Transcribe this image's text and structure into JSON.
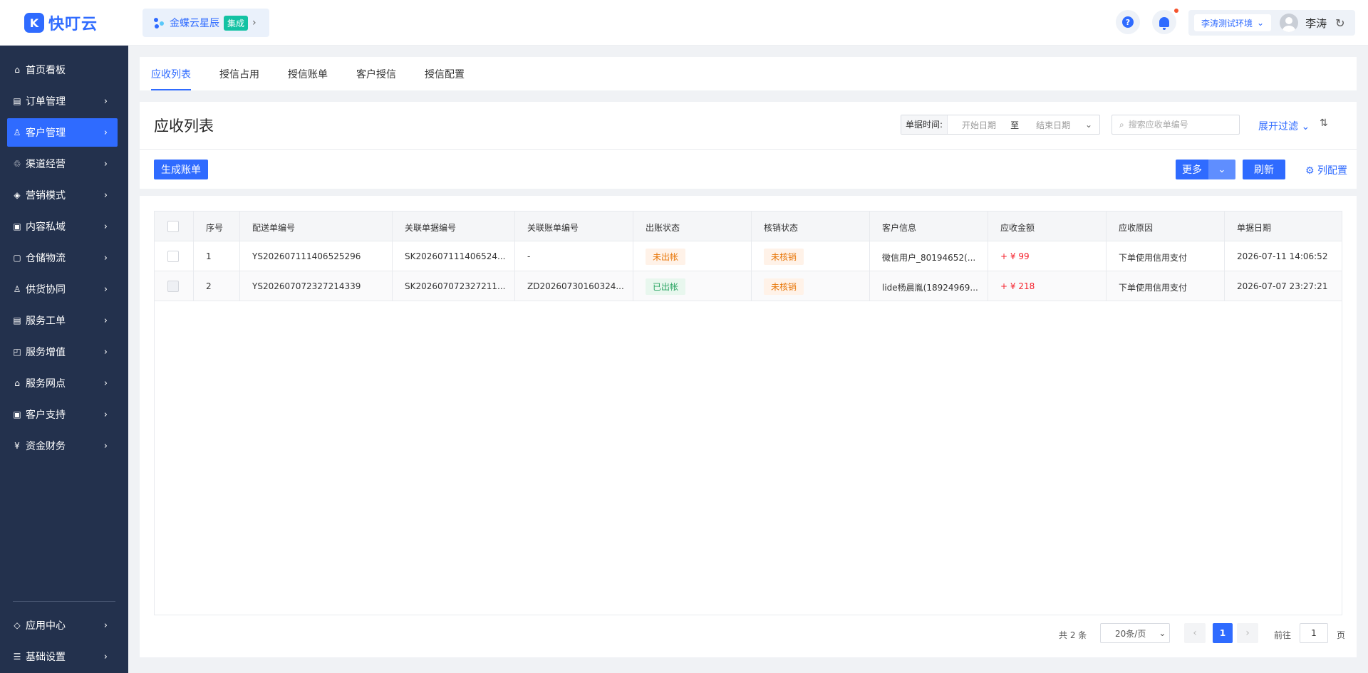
{
  "app": {
    "logo_mark": "K",
    "logo_text": "快叮云"
  },
  "integration": {
    "name": "金蝶云星辰",
    "tag": "集成"
  },
  "header": {
    "help": "?",
    "environment": "李涛测试环境",
    "user": "李涛"
  },
  "sidebar": {
    "items": [
      {
        "label": "首页看板",
        "icon": "home-icon",
        "glyph": "⌂"
      },
      {
        "label": "订单管理",
        "icon": "order-icon",
        "glyph": "▤"
      },
      {
        "label": "客户管理",
        "icon": "user-icon",
        "glyph": "♙"
      },
      {
        "label": "渠道经营",
        "icon": "channel-icon",
        "glyph": "♲"
      },
      {
        "label": "营销模式",
        "icon": "tag-icon",
        "glyph": "◈"
      },
      {
        "label": "内容私域",
        "icon": "image-icon",
        "glyph": "▣"
      },
      {
        "label": "仓储物流",
        "icon": "warehouse-icon",
        "glyph": "▢"
      },
      {
        "label": "供货协同",
        "icon": "supply-icon",
        "glyph": "♙"
      },
      {
        "label": "服务工单",
        "icon": "ticket-icon",
        "glyph": "▤"
      },
      {
        "label": "服务增值",
        "icon": "bag-icon",
        "glyph": "◰"
      },
      {
        "label": "服务网点",
        "icon": "store-icon",
        "glyph": "⌂"
      },
      {
        "label": "客户支持",
        "icon": "support-icon",
        "glyph": "▣"
      },
      {
        "label": "资金财务",
        "icon": "finance-icon",
        "glyph": "¥"
      }
    ],
    "bottom_items": [
      {
        "label": "应用中心",
        "icon": "app-center-icon",
        "glyph": "◇"
      },
      {
        "label": "基础设置",
        "icon": "settings-icon",
        "glyph": "☰"
      }
    ]
  },
  "tabs": [
    "应收列表",
    "授信占用",
    "授信账单",
    "客户授信",
    "授信配置"
  ],
  "page": {
    "title": "应收列表",
    "date_label": "单据时间:",
    "date_start_placeholder": "开始日期",
    "date_to": "至",
    "date_end_placeholder": "结束日期",
    "search_placeholder": "搜索应收单编号",
    "expand_filter": "展开过滤",
    "generate_bill": "生成账单",
    "more": "更多",
    "refresh": "刷新",
    "column_config": "列配置"
  },
  "table": {
    "columns": [
      "序号",
      "配送单编号",
      "关联单据编号",
      "关联账单编号",
      "出账状态",
      "核销状态",
      "客户信息",
      "应收金额",
      "应收原因",
      "单据日期"
    ],
    "rows": [
      {
        "index": "1",
        "delivery_no": "YS202607111406525296",
        "related_doc": "SK202607111406524...",
        "related_bill": "-",
        "bill_status": "未出帐",
        "writeoff_status": "未核销",
        "customer": "微信用户_80194652(...",
        "amount": "+ ¥ 99",
        "reason": "下单使用信用支付",
        "date": "2026-07-11 14:06:52"
      },
      {
        "index": "2",
        "delivery_no": "YS202607072327214339",
        "related_doc": "SK202607072327211...",
        "related_bill": "ZD20260730160324...",
        "bill_status": "已出帐",
        "writeoff_status": "未核销",
        "customer": "lide杨晨胤(18924969...",
        "amount": "+ ¥ 218",
        "reason": "下单使用信用支付",
        "date": "2026-07-07 23:27:21"
      }
    ]
  },
  "pagination": {
    "total": "共 2 条",
    "page_size": "20条/页",
    "current": "1",
    "goto": "前往",
    "goto_value": "1",
    "unit": "页"
  },
  "colors": {
    "primary": "#2f6bff",
    "sidebar": "#23314d",
    "warning": "#e8780b",
    "success": "#2ba563",
    "danger": "#f5222d"
  }
}
